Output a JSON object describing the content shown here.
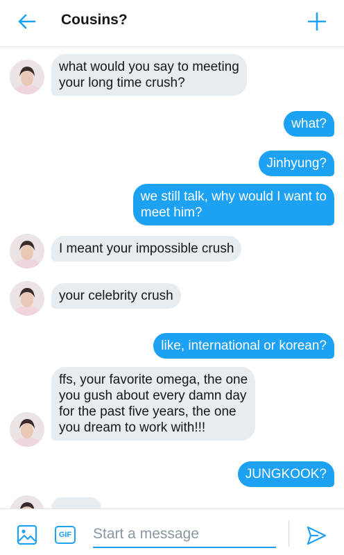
{
  "header": {
    "title": "Cousins?",
    "back_icon": "arrow-left-icon",
    "add_icon": "plus-icon"
  },
  "colors": {
    "accent": "#1da1f2",
    "incoming_bubble": "#e6ecf0",
    "outgoing_bubble": "#1da1f2"
  },
  "messages": [
    {
      "from": "them",
      "text": "what would you say to meeting\nyour long time crush?"
    },
    {
      "from": "me",
      "text": "what?"
    },
    {
      "from": "me",
      "text": "Jinhyung?"
    },
    {
      "from": "me",
      "text": "we still talk, why would I want to\nmeet him?"
    },
    {
      "from": "them",
      "text": "I meant your impossible crush"
    },
    {
      "from": "them",
      "text": "your celebrity crush"
    },
    {
      "from": "me",
      "text": "like, international or korean?"
    },
    {
      "from": "them",
      "text": "ffs, your favorite omega, the one\nyou gush about every damn day\nfor the past five years, the one\nyou dream to work with!!!"
    },
    {
      "from": "me",
      "text": "JUNGKOOK?"
    }
  ],
  "composer": {
    "placeholder": "Start a message",
    "value": "",
    "gif_label": "GIF",
    "media_icon": "image-icon",
    "send_icon": "send-icon"
  }
}
